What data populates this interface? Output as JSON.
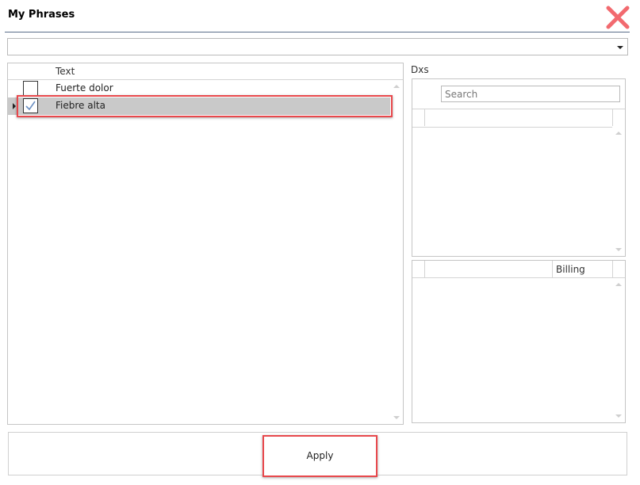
{
  "window": {
    "title": "My Phrases"
  },
  "combo": {
    "value": ""
  },
  "phrases": {
    "header_text": "Text",
    "rows": [
      {
        "text": "Fuerte dolor",
        "checked": false
      },
      {
        "text": "Fiebre alta",
        "checked": true
      }
    ]
  },
  "dxs": {
    "label": "Dxs",
    "search_placeholder": "Search"
  },
  "billing": {
    "header": "Billing"
  },
  "actions": {
    "apply_label": "Apply"
  },
  "colors": {
    "close": "#f26a6f",
    "highlight": "#e8484c",
    "check": "#6b8fc2",
    "selected_row": "#c9c9c9"
  },
  "icons": {
    "close": "close-icon",
    "dropdown": "chevron-down-icon",
    "check": "checkmark-icon",
    "row_indicator": "row-pointer-icon"
  }
}
